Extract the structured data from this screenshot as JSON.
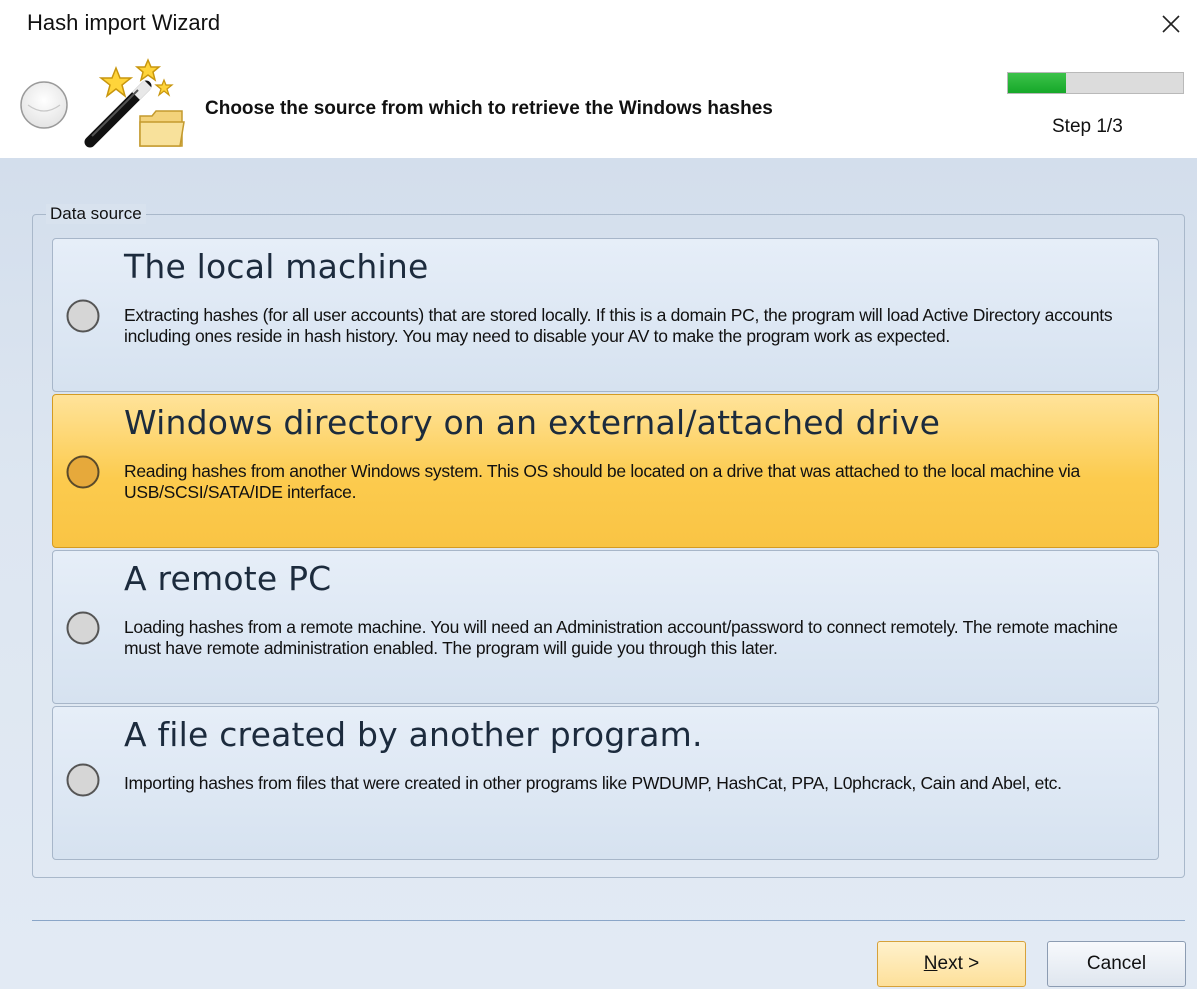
{
  "window": {
    "title": "Hash import Wizard"
  },
  "header": {
    "instruction": "Choose the source from which to retrieve the Windows hashes",
    "step_label": "Step 1/3",
    "progress_fraction": 0.33,
    "progress_color": "#22b334"
  },
  "group": {
    "legend": "Data source"
  },
  "options": [
    {
      "title": "The local machine",
      "description": "Extracting hashes (for all user accounts) that are stored locally. If this is a domain PC, the program will load Active Directory accounts including ones reside in hash history. You may need to disable your AV to make the program work as expected.",
      "selected": false
    },
    {
      "title": "Windows directory on an external/attached drive",
      "description": "Reading hashes from another Windows system. This OS should be located on a drive that was attached to the local machine via USB/SCSI/SATA/IDE interface.",
      "selected": true
    },
    {
      "title": "A remote PC",
      "description": "Loading hashes from a remote machine. You will need an Administration account/password to connect remotely. The remote machine must have remote administration enabled. The program will guide you through this later.",
      "selected": false
    },
    {
      "title": "A file created by another program.",
      "description": "Importing hashes from files that were created in other programs like PWDUMP, HashCat, PPA, L0phcrack, Cain and Abel, etc.",
      "selected": false
    }
  ],
  "buttons": {
    "next_label": "Next >",
    "cancel_label": "Cancel"
  },
  "icons": {
    "close": "close-icon",
    "header_circle": "circle-icon",
    "wizard": "magic-wand-folder-icon",
    "radio": "radio-button-icon"
  },
  "colors": {
    "selected_option": "#fccb4e",
    "option_background": "#dde6f1",
    "body_background": "#dde6f1"
  }
}
